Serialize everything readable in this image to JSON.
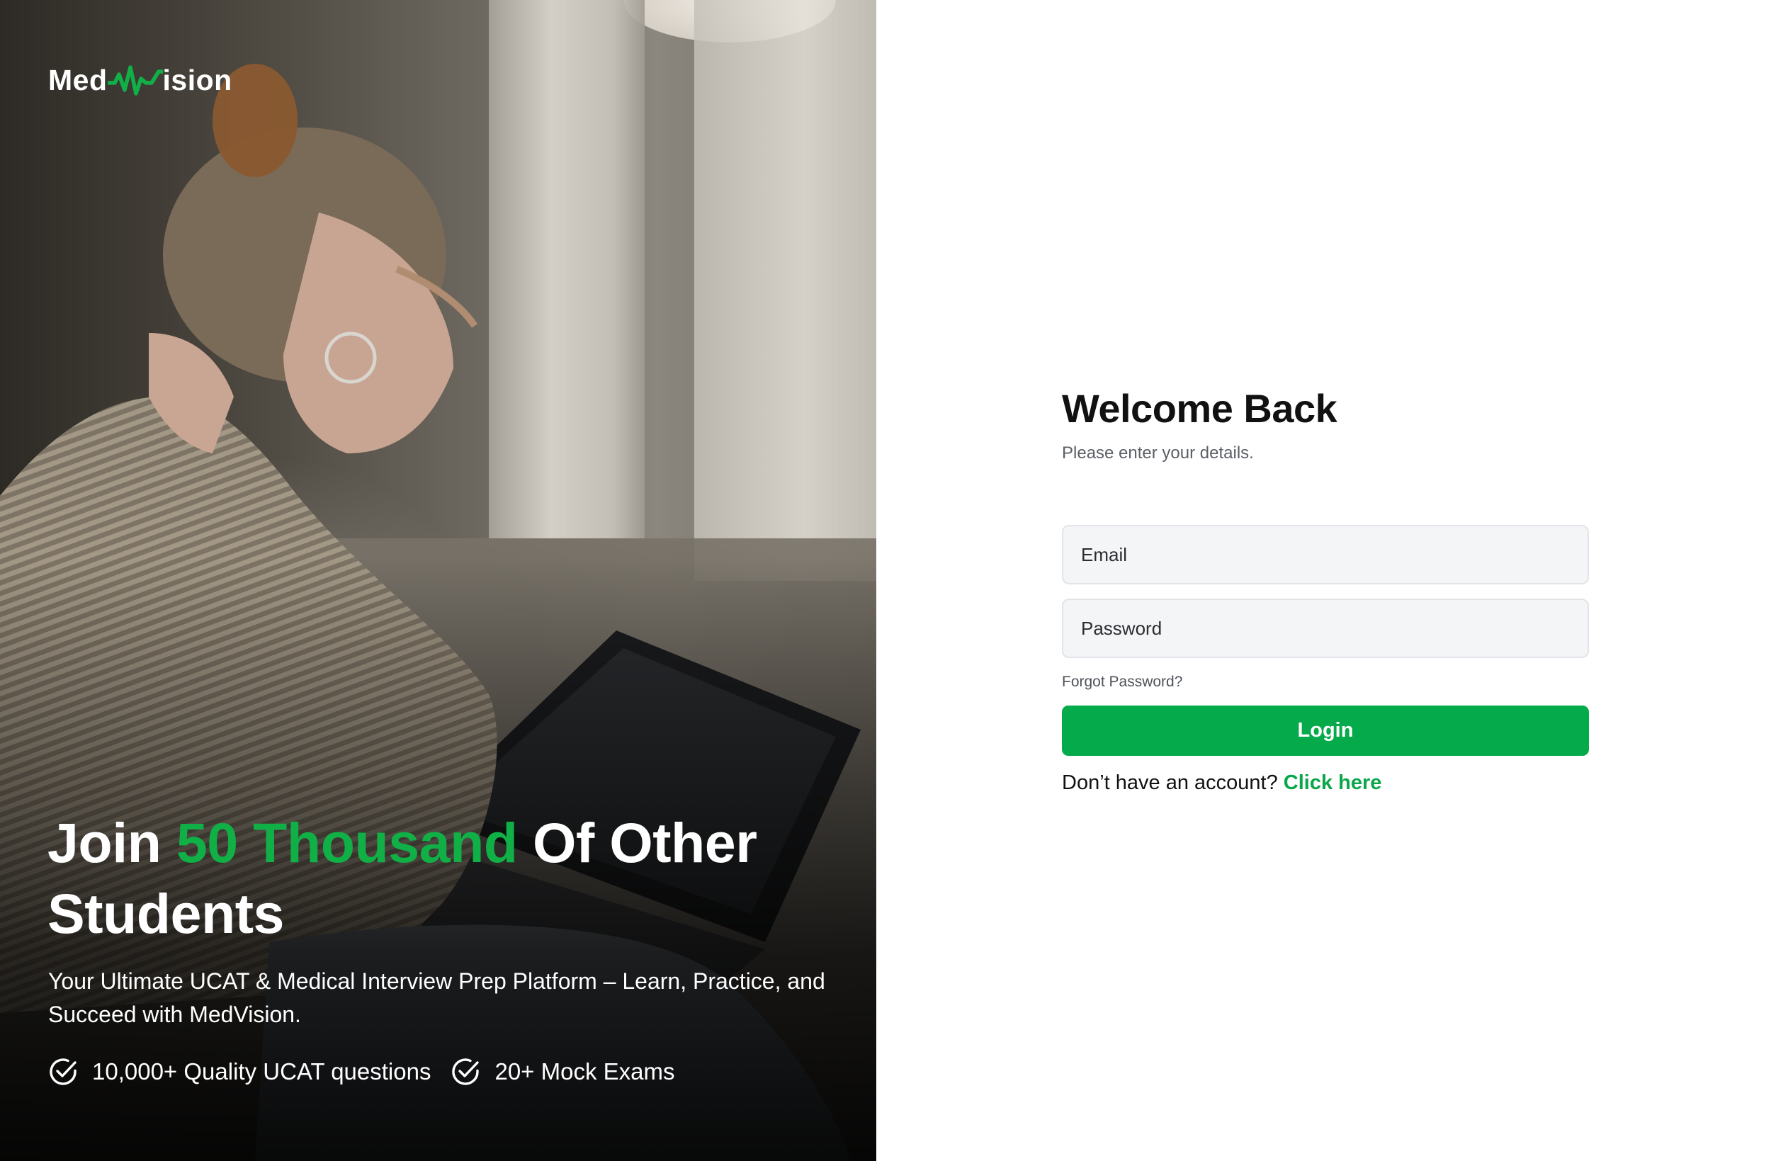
{
  "brand": {
    "logo_text_left": "Med",
    "logo_text_right": "ision",
    "accent_color": "#10b047"
  },
  "hero": {
    "headline_start": "Join ",
    "headline_highlight": "50 Thousand",
    "headline_end": " Of Other Students",
    "subtitle": "Your Ultimate UCAT & Medical Interview Prep Platform – Learn, Practice, and Succeed with MedVision.",
    "features": [
      {
        "icon": "check-circle-icon",
        "label": "10,000+ Quality UCAT questions"
      },
      {
        "icon": "check-circle-icon",
        "label": "20+ Mock Exams"
      }
    ]
  },
  "login": {
    "title": "Welcome Back",
    "subtitle": "Please enter your details.",
    "email_placeholder": "Email",
    "password_placeholder": "Password",
    "forgot_label": "Forgot Password?",
    "submit_label": "Login",
    "signup_prompt": "Don’t have an account?",
    "signup_link": "Click here",
    "button_color": "#05ab4a"
  }
}
